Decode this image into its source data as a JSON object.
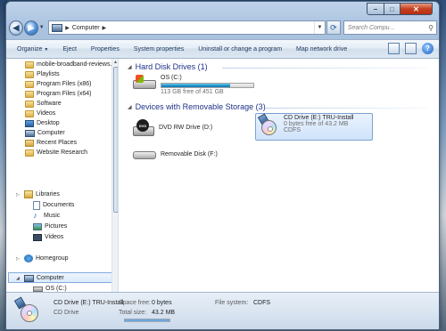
{
  "window": {
    "address_path": "Computer",
    "search_placeholder": "Search Compu...",
    "caption": {
      "minimize": "–",
      "maximize": "□",
      "close": "✕"
    }
  },
  "toolbar": {
    "organize": "Organize",
    "eject": "Eject",
    "properties": "Properties",
    "system_properties": "System properties",
    "uninstall": "Uninstall or change a program",
    "map_drive": "Map network drive"
  },
  "sidebar": {
    "favorites": [
      {
        "label": "mobile-broadband-reviews.c"
      },
      {
        "label": "Playlists"
      },
      {
        "label": "Program Files (x86)"
      },
      {
        "label": "Program Files (x64)"
      },
      {
        "label": "Software"
      },
      {
        "label": "Videos"
      },
      {
        "label": "Desktop"
      },
      {
        "label": "Computer"
      },
      {
        "label": "Recent Places"
      },
      {
        "label": "Website Research"
      }
    ],
    "libraries": {
      "label": "Libraries",
      "items": [
        {
          "label": "Documents"
        },
        {
          "label": "Music"
        },
        {
          "label": "Pictures"
        },
        {
          "label": "Videos"
        }
      ]
    },
    "homegroup": "Homegroup",
    "computer": {
      "label": "Computer",
      "items": [
        {
          "label": "OS (C:)"
        }
      ]
    }
  },
  "content": {
    "hdd_group": {
      "title": "Hard Disk Drives (1)",
      "drives": [
        {
          "name": "OS (C:)",
          "space": "113 GB free of 451 GB",
          "used_fraction": 0.75
        }
      ]
    },
    "removable_group": {
      "title": "Devices with Removable Storage (3)",
      "drives": [
        {
          "name": "DVD RW Drive (D:)"
        },
        {
          "name": "CD Drive (E:) TRU-Install",
          "space": "0 bytes free of 43.2 MB",
          "fs": "CDFS"
        },
        {
          "name": "Removable Disk (F:)"
        }
      ]
    },
    "dvd_disc_text": "DVD"
  },
  "details": {
    "name": "CD Drive (E:) TRU-Install",
    "type": "CD Drive",
    "space_free_label": "Space free:",
    "space_free_value": "0 bytes",
    "total_size_label": "Total size:",
    "total_size_value": "43.2 MB",
    "fs_label": "File system:",
    "fs_value": "CDFS",
    "used_fraction": 1.0
  }
}
